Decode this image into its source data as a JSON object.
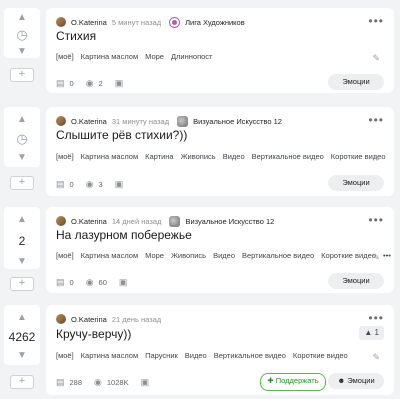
{
  "common": {
    "up": "▲",
    "down": "▼",
    "plus": "+",
    "dots": "•••",
    "pencil": "✎",
    "comment_icon": "▤",
    "view_icon": "◉",
    "save_icon": "▣",
    "emotions": "Эмоции",
    "support": "Поддержать"
  },
  "posts": [
    {
      "rating": "◷",
      "author": "O.Katerina",
      "time": "5 минут назад",
      "community": "Лига Художников",
      "title": "Стихия",
      "tags": [
        "[моё]",
        "Картина маслом",
        "Море",
        "Длиннопост"
      ],
      "comments": "0",
      "views": "2"
    },
    {
      "rating": "◷",
      "author": "O.Katerina",
      "time": "31 минуту назад",
      "community": "Визуальное Искусство 12",
      "title": "Слышите рёв стихии?))",
      "tags": [
        "[моё]",
        "Картина маслом",
        "Картина",
        "Живопись",
        "Видео",
        "Вертикальное видео",
        "Короткие видео"
      ],
      "comments": "0",
      "views": "3"
    },
    {
      "rating": "2",
      "author": "O.Katerina",
      "time": "14 дней назад",
      "community": "Визуальное Искусство 12",
      "title": "На лазурном побережье",
      "tags": [
        "[моё]",
        "Картина маслом",
        "Море",
        "Живопись",
        "Видео",
        "Вертикальное видео",
        "Короткие видео",
        "•••"
      ],
      "comments": "0",
      "views": "60"
    },
    {
      "rating": "4262",
      "author": "O.Katerina",
      "time": "21 день назад",
      "title": "Кручу-верчу))",
      "badge": "1",
      "tags": [
        "[моё]",
        "Картина маслом",
        "Парусник",
        "Видео",
        "Вертикальное видео",
        "Короткие видео"
      ],
      "comments": "288",
      "views": "1028K"
    }
  ]
}
